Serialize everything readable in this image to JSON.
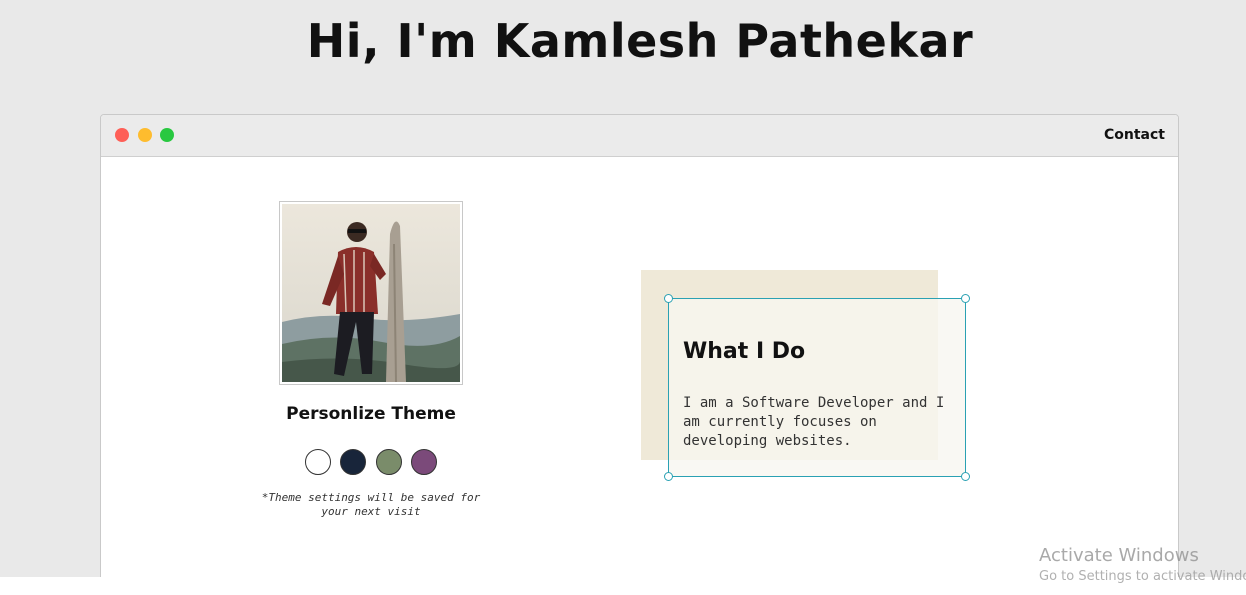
{
  "page": {
    "headline": "Hi, I'm Kamlesh Pathekar"
  },
  "window": {
    "controls": [
      "close",
      "minimize",
      "maximize"
    ],
    "nav": {
      "contact_label": "Contact"
    }
  },
  "profile": {
    "icon": "profile-photo"
  },
  "theme": {
    "title": "Personlize Theme",
    "swatches": [
      {
        "name": "white",
        "color": "#ffffff"
      },
      {
        "name": "navy",
        "color": "#18253a"
      },
      {
        "name": "sage",
        "color": "#7a8c6a"
      },
      {
        "name": "plum",
        "color": "#7b4a7a"
      }
    ],
    "note": "*Theme settings will be saved for your next visit"
  },
  "intro_card": {
    "title": "What I Do",
    "text": "I am a Software Developer and I am currently focuses on developing websites."
  },
  "os_overlay": {
    "activate_title": "Activate Windows",
    "activate_sub": "Go to Settings to activate Windows."
  },
  "colors": {
    "page_bg": "#e9e9e9",
    "accent_border": "#2aa1b3",
    "card_bg": "#efe9d8"
  }
}
